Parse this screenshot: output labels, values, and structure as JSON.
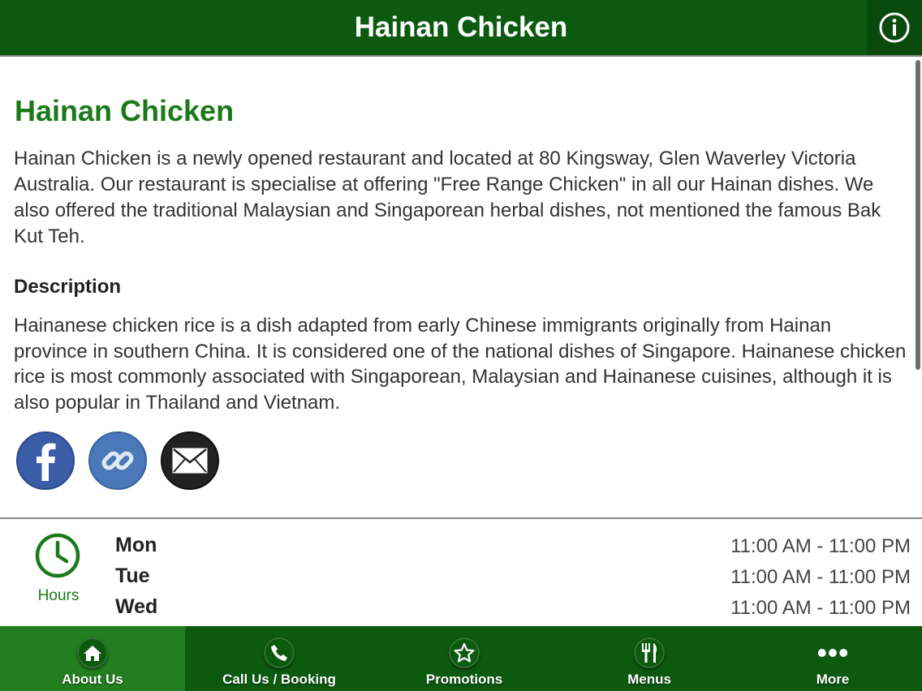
{
  "header": {
    "title": "Hainan Chicken",
    "info_icon": "info-icon"
  },
  "main": {
    "heading": "Hainan Chicken",
    "intro": "Hainan Chicken is a newly opened restaurant and located at 80 Kingsway, Glen Waverley Victoria Australia. Our restaurant is specialise at offering \"Free Range Chicken\" in all our Hainan dishes. We also offered the traditional Malaysian and Singaporean herbal dishes, not mentioned the famous Bak Kut Teh.",
    "description_title": "Description",
    "description_text": "Hainanese chicken rice is a dish adapted from early Chinese immigrants originally from Hainan province in southern China. It is considered one of the national dishes of Singapore. Hainanese chicken rice is most commonly associated with Singaporean, Malaysian and Hainanese cuisines, although it is also popular in Thailand and Vietnam.",
    "social": [
      {
        "icon": "facebook-icon"
      },
      {
        "icon": "link-icon"
      },
      {
        "icon": "email-icon"
      }
    ]
  },
  "hours": {
    "label": "Hours",
    "icon": "clock-icon",
    "rows": [
      {
        "day": "Mon",
        "time": "11:00 AM - 11:00 PM"
      },
      {
        "day": "Tue",
        "time": "11:00 AM - 11:00 PM"
      },
      {
        "day": "Wed",
        "time": "11:00 AM - 11:00 PM"
      }
    ]
  },
  "tabs": [
    {
      "label": "About Us",
      "icon": "home-icon",
      "active": true
    },
    {
      "label": "Call Us / Booking",
      "icon": "phone-icon",
      "active": false
    },
    {
      "label": "Promotions",
      "icon": "star-icon",
      "active": false
    },
    {
      "label": "Menus",
      "icon": "fork-knife-icon",
      "active": false
    },
    {
      "label": "More",
      "icon": "more-dots-icon",
      "active": false
    }
  ],
  "colors": {
    "brand_green": "#0c5a10",
    "active_tab": "#237e1f",
    "heading_green": "#1a7a1a"
  }
}
